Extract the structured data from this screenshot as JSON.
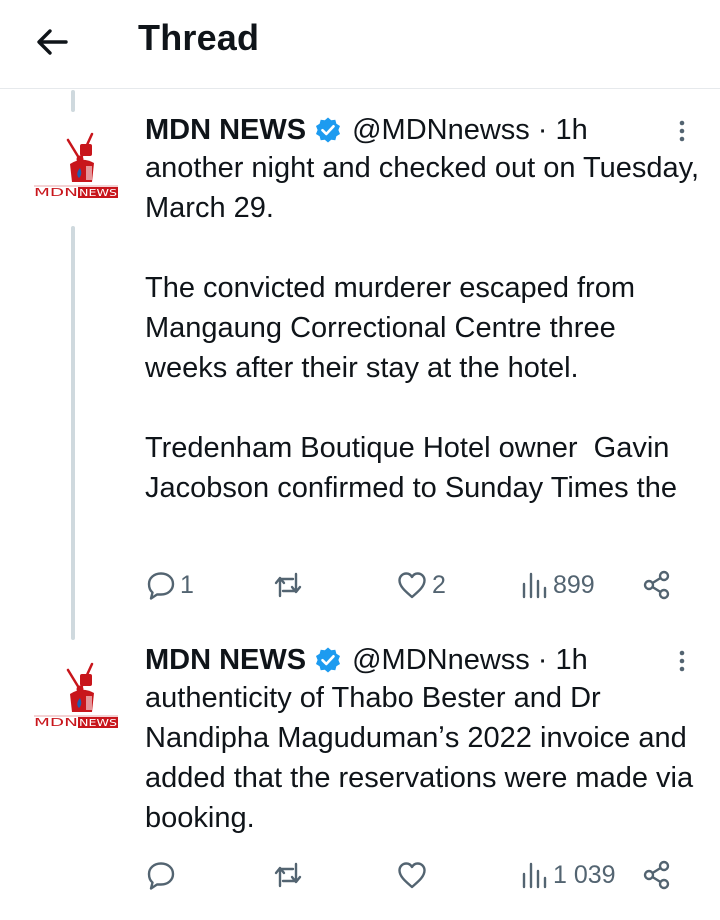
{
  "header": {
    "title": "Thread",
    "back_icon": "arrow-left-icon"
  },
  "colors": {
    "text": "#0f1419",
    "secondary": "#536471",
    "verified": "#1d9bf0",
    "thread_line": "#cfd9de",
    "logo_red": "#c8151b"
  },
  "tweets": [
    {
      "author": "MDN NEWS",
      "handle": "@MDNnewss",
      "separator": "·",
      "time": "1h",
      "verified": true,
      "logo_text": "MDNNEWS",
      "text": [
        "another night and checked out on Tuesday, March 29.",
        "The convicted murderer escaped from Mangaung Correctional Centre three weeks after their stay at the hotel.",
        "Tredenham Boutique Hotel owner  Gavin Jacobson confirmed to Sunday Times the"
      ],
      "stats": {
        "replies": "1",
        "reposts": "",
        "likes": "2",
        "views": "899"
      }
    },
    {
      "author": "MDN NEWS",
      "handle": "@MDNnewss",
      "separator": "·",
      "time": "1h",
      "verified": true,
      "logo_text": "MDNNEWS",
      "text": [
        "authenticity of Thabo Bester and Dr Nandipha Magudumanʼs 2022 invoice and added that the reservations were made via booking."
      ],
      "stats": {
        "replies": "",
        "reposts": "",
        "likes": "",
        "views": "1 039"
      }
    }
  ]
}
